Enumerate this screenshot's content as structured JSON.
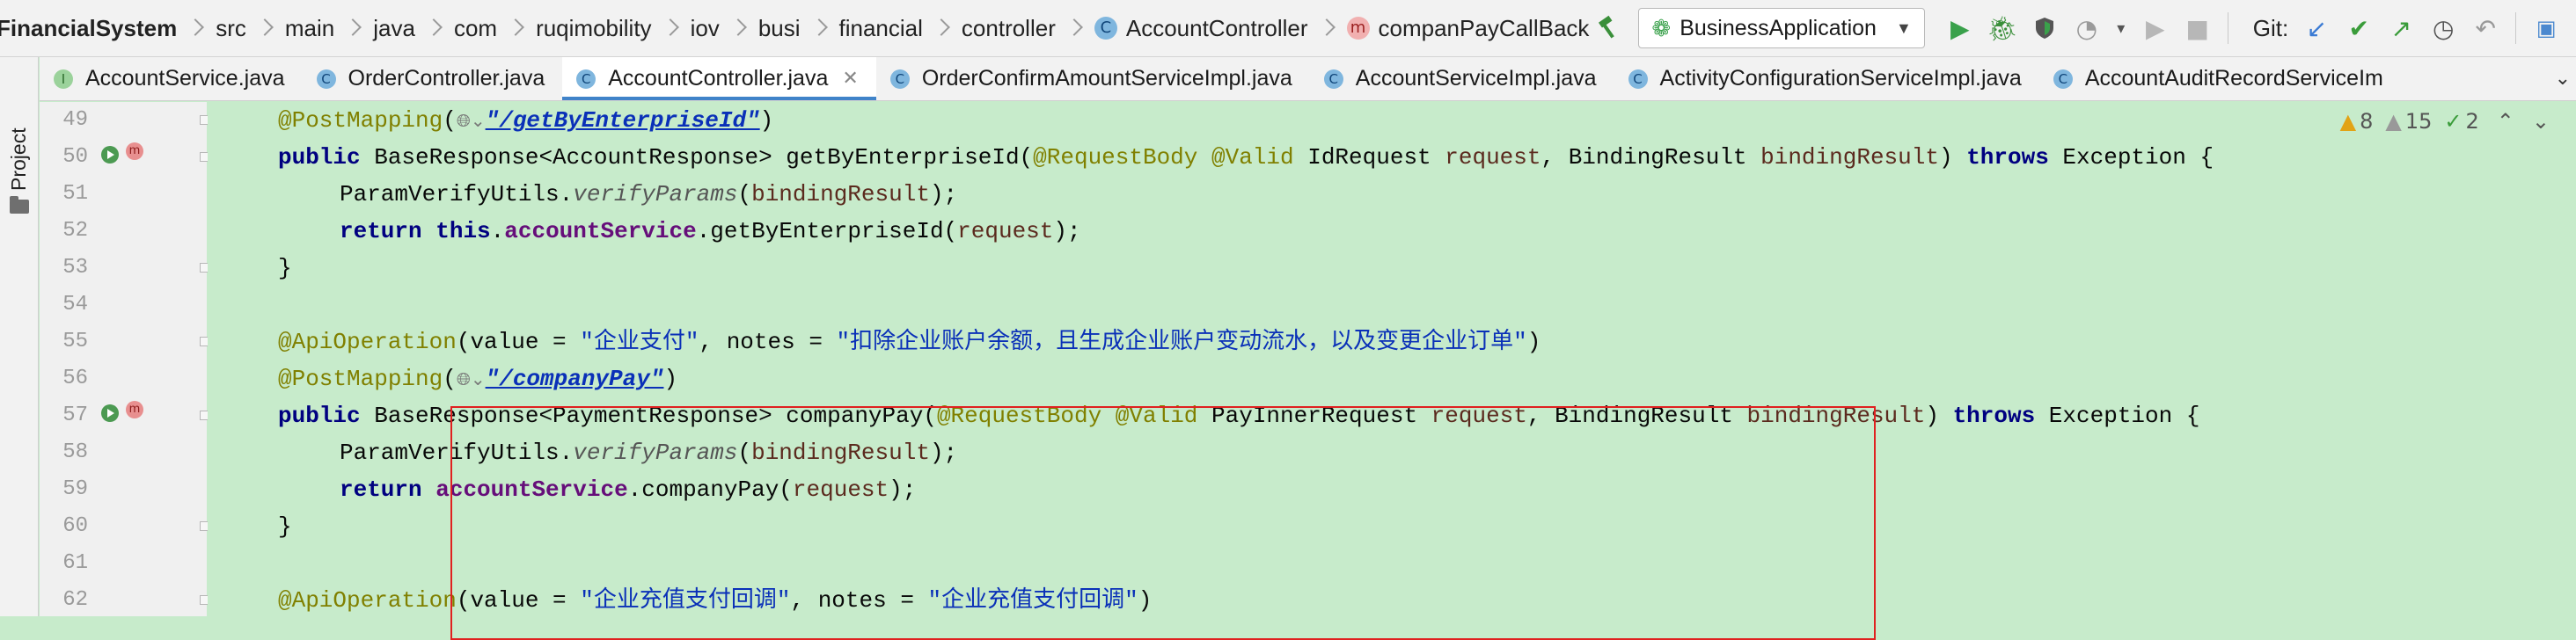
{
  "breadcrumb": [
    {
      "label": "FinancialSystem"
    },
    {
      "label": "src"
    },
    {
      "label": "main"
    },
    {
      "label": "java"
    },
    {
      "label": "com"
    },
    {
      "label": "ruqimobility"
    },
    {
      "label": "iov"
    },
    {
      "label": "busi"
    },
    {
      "label": "financial"
    },
    {
      "label": "controller"
    },
    {
      "label": "AccountController",
      "icon": "class-icon"
    },
    {
      "label": "companPayCallBack",
      "icon": "method-icon"
    }
  ],
  "toolbar": {
    "run_config": "BusinessApplication",
    "git_label": "Git:",
    "icons": [
      "build-hammer-icon",
      "run-icon",
      "debug-icon",
      "coverage-icon",
      "profile-icon",
      "stop-icon",
      "git-update-icon",
      "git-commit-icon",
      "git-push-icon",
      "history-icon",
      "rollback-icon",
      "translate-icon",
      "search-icon"
    ]
  },
  "tabs": [
    {
      "label": "AccountService.java",
      "icon": "interface-icon",
      "icon_letter": "I"
    },
    {
      "label": "OrderController.java",
      "icon": "class-icon",
      "icon_letter": "C"
    },
    {
      "label": "AccountController.java",
      "icon": "class-icon",
      "icon_letter": "C",
      "active": true
    },
    {
      "label": "OrderConfirmAmountServiceImpl.java",
      "icon": "class-icon",
      "icon_letter": "C"
    },
    {
      "label": "AccountServiceImpl.java",
      "icon": "class-icon",
      "icon_letter": "C"
    },
    {
      "label": "ActivityConfigurationServiceImpl.java",
      "icon": "class-icon",
      "icon_letter": "C"
    },
    {
      "label": "AccountAuditRecordServiceIm",
      "icon": "class-icon",
      "icon_letter": "C"
    }
  ],
  "sidebar": {
    "project_label": "Project"
  },
  "inspections": {
    "warnings": "8",
    "weak_warnings": "15",
    "typos": "2"
  },
  "line_numbers": [
    "49",
    "50",
    "51",
    "52",
    "53",
    "54",
    "55",
    "56",
    "57",
    "58",
    "59",
    "60",
    "61",
    "62"
  ],
  "code": {
    "l49": {
      "ann": "@PostMapping",
      "open": "(",
      "url": "\"/getByEnterpriseId\"",
      "close": ")"
    },
    "l50": {
      "kw1": "public",
      "t1": " BaseResponse<AccountResponse> getByEnterpriseId(",
      "a1": "@RequestBody",
      "a2": "@Valid",
      "t2": " IdRequest ",
      "p1": "request",
      "t3": ", BindingResult ",
      "p2": "bindingResult",
      "t4": ") ",
      "kw2": "throws",
      "t5": " Exception {"
    },
    "l51": {
      "t1": "ParamVerifyUtils.",
      "it": "verifyParams",
      "t2": "(",
      "p1": "bindingResult",
      "t3": ");"
    },
    "l52": {
      "kw1": "return",
      "kw2": "this",
      "t1": ".",
      "f1": "accountService",
      "t2": ".getByEnterpriseId(",
      "p1": "request",
      "t3": ");"
    },
    "l53": {
      "t1": "}"
    },
    "l55": {
      "ann": "@ApiOperation",
      "t1": "(value = ",
      "s1": "\"企业支付\"",
      "t2": ", notes = ",
      "s2": "\"扣除企业账户余额，且生成企业账户变动流水，以及变更企业订单\"",
      "t3": ")"
    },
    "l56": {
      "ann": "@PostMapping",
      "open": "(",
      "url": "\"/companyPay\"",
      "close": ")"
    },
    "l57": {
      "kw1": "public",
      "t1": " BaseResponse<PaymentResponse> companyPay(",
      "a1": "@RequestBody",
      "a2": "@Valid",
      "t2": " PayInnerRequest ",
      "p1": "request",
      "t3": ", BindingResult ",
      "p2": "bindingResult",
      "t4": ") ",
      "kw2": "throws",
      "t5": " Exception {"
    },
    "l58": {
      "t1": "ParamVerifyUtils.",
      "it": "verifyParams",
      "t2": "(",
      "p1": "bindingResult",
      "t3": ");"
    },
    "l59": {
      "kw1": "return",
      "f1": "accountService",
      "t2": ".companyPay(",
      "p1": "request",
      "t3": ");"
    },
    "l60": {
      "t1": "}"
    },
    "l62": {
      "ann": "@ApiOperation",
      "t1": "(value = ",
      "s1": "\"企业充值支付回调\"",
      "t2": ", notes = ",
      "s2": "\"企业充值支付回调\"",
      "t3": ")"
    }
  }
}
